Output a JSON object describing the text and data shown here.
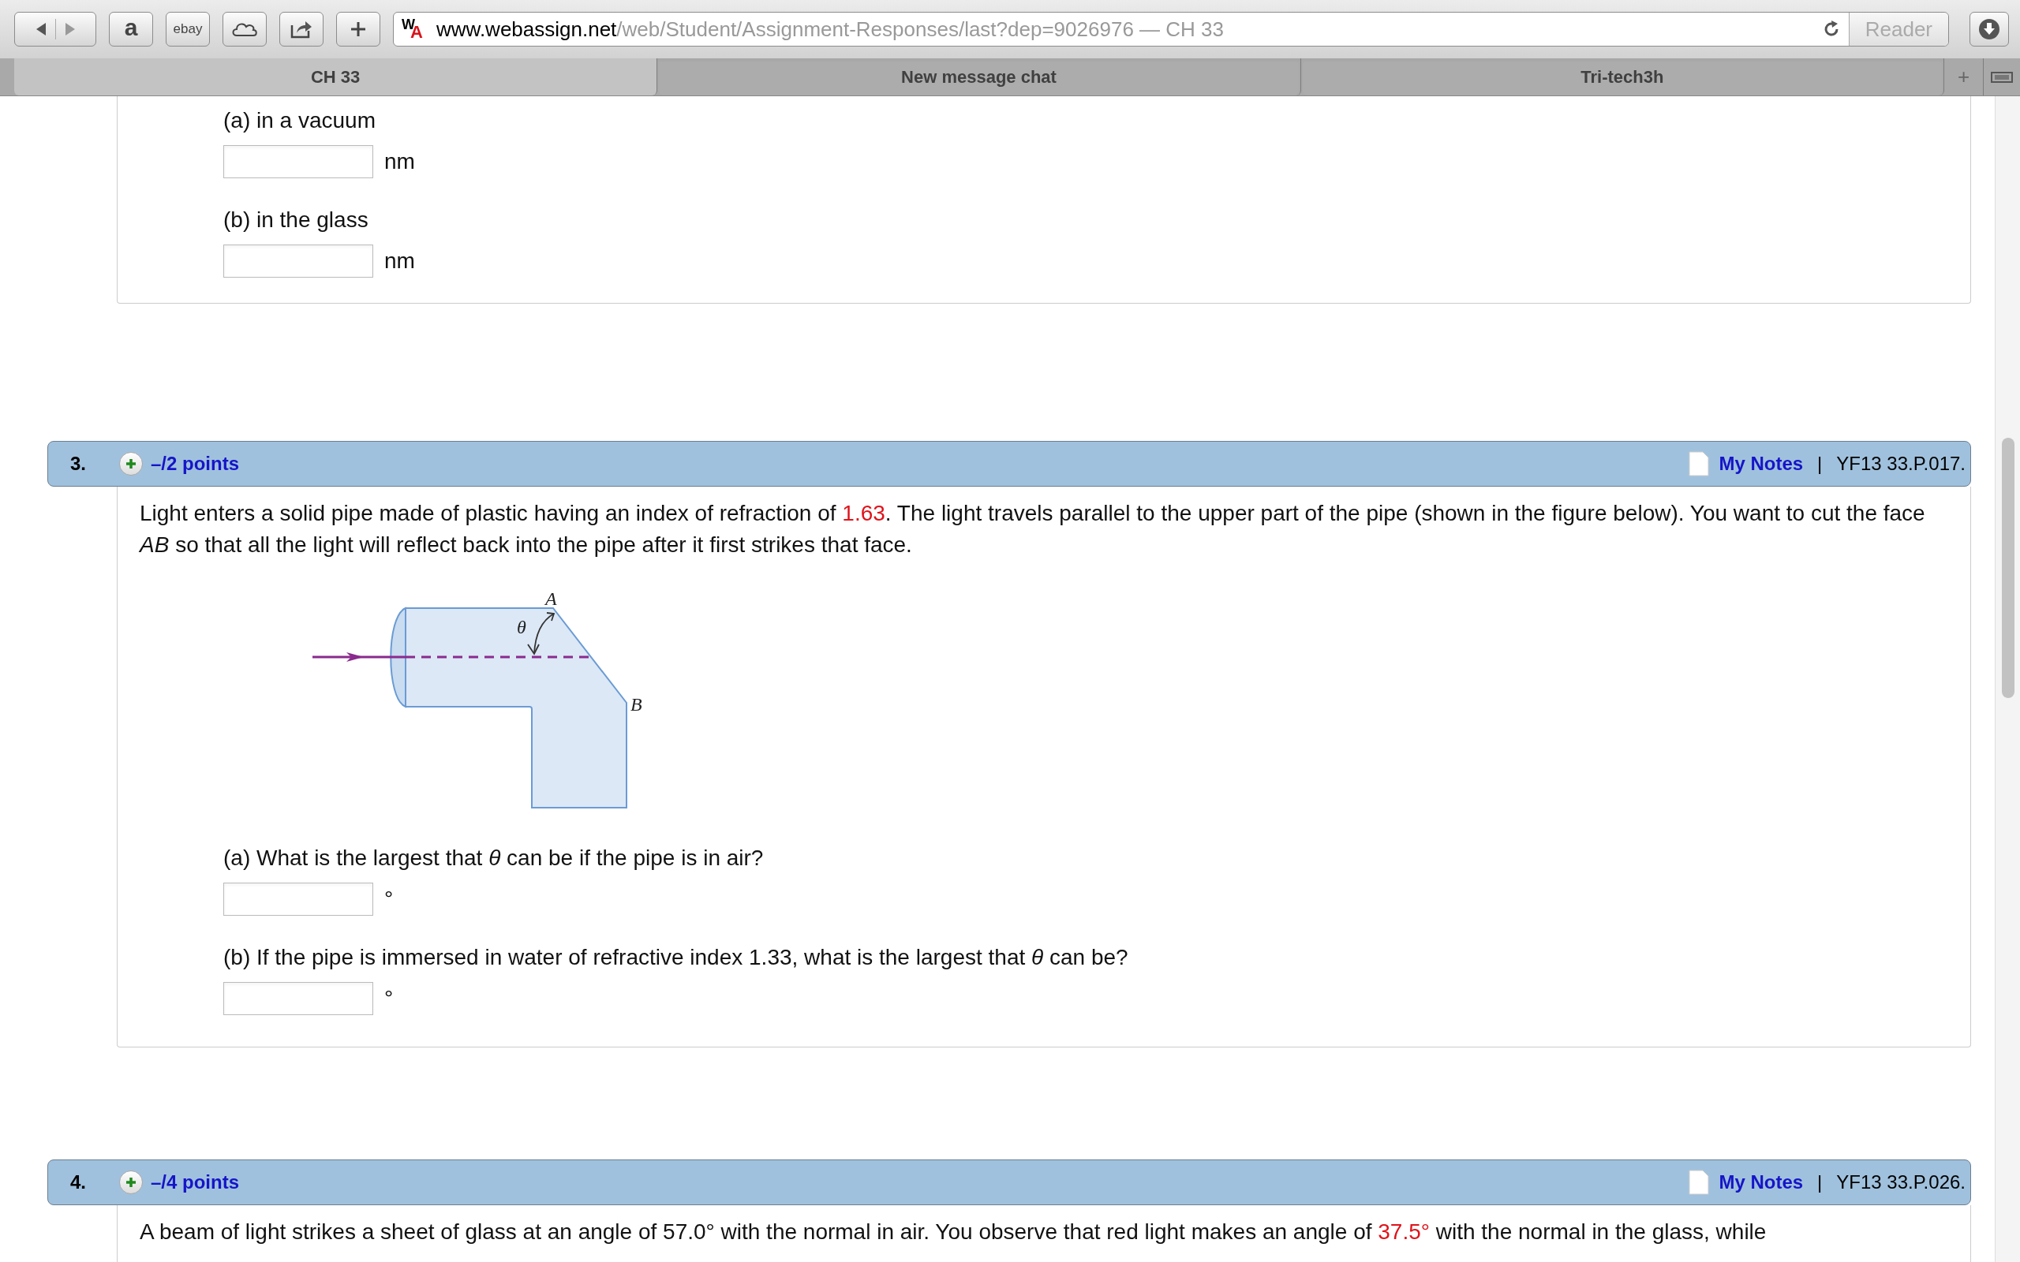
{
  "browser": {
    "bookmarks": {
      "amazon": "a",
      "ebay": "ebay"
    },
    "site_logo": "WA",
    "url_domain": "www.webassign.net",
    "url_path": "/web/Student/Assignment-Responses/last?dep=9026976",
    "page_title": " — CH 33",
    "reader": "Reader",
    "tabs": [
      {
        "label": "CH 33",
        "selected": true
      },
      {
        "label": "New message chat",
        "selected": false
      },
      {
        "label": "Tri-tech3h",
        "selected": false
      }
    ],
    "new_tab": "+"
  },
  "previous_question": {
    "parts": [
      {
        "label": "(a) in a vacuum",
        "unit": "nm"
      },
      {
        "label": "(b) in the glass",
        "unit": "nm"
      }
    ]
  },
  "questions": [
    {
      "number": "3.",
      "points": "–/2 points",
      "notes": "My Notes",
      "separator": "|",
      "code": "YF13 33.P.017.",
      "text": [
        {
          "text": "Light enters a solid pipe made of plastic having an index of refraction of ",
          "highlight": false
        },
        {
          "text": "1.63",
          "highlight": true
        },
        {
          "text": ". The light travels parallel to the upper part of the pipe (shown in the figure below). You want to cut the face *AB* so that all the light will reflect back into the pipe after it first strikes that face.",
          "highlight": false
        }
      ],
      "figure": {
        "labels": [
          "A",
          "B",
          "θ"
        ]
      },
      "parts": [
        {
          "label": "(a) What is the largest that *θ* can be if the pipe is in air?",
          "unit": "°"
        },
        {
          "label": "(b) If the pipe is immersed in water of refractive index 1.33, what is the largest that *θ* can be?",
          "unit": "°"
        }
      ]
    },
    {
      "number": "4.",
      "points": "–/4 points",
      "notes": "My Notes",
      "separator": "|",
      "code": "YF13 33.P.026.",
      "text": [
        {
          "text": "A beam of light strikes a sheet of glass at an angle of 57.0° with the normal in air. You observe that red light makes an angle of ",
          "highlight": false
        },
        {
          "text": "37.5°",
          "highlight": true
        },
        {
          "text": " with the normal in the glass, while",
          "highlight": false
        }
      ]
    }
  ]
}
